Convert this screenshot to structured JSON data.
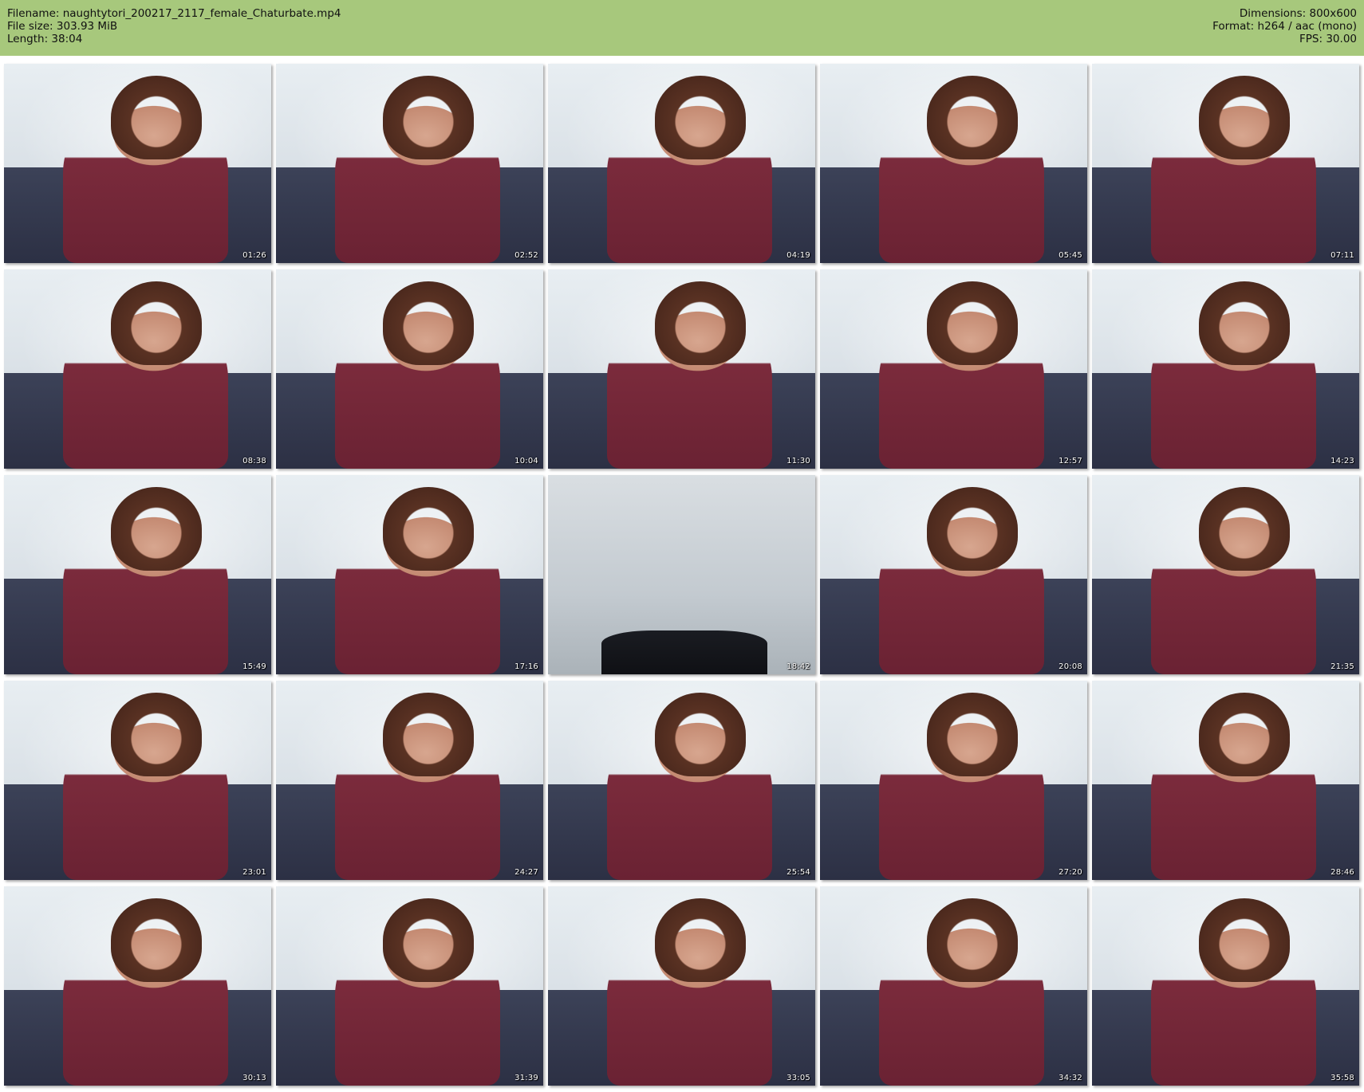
{
  "header": {
    "filename": "Filename: naughtytori_200217_2117_female_Chaturbate.mp4",
    "filesize": "File size: 303.93 MiB",
    "length": "Length: 38:04",
    "dimensions": "Dimensions: 800x600",
    "format": "Format: h264 / aac (mono)",
    "fps": "FPS: 30.00",
    "background_color": "#a7c87c"
  },
  "thumbnails": [
    {
      "timestamp": "01:26"
    },
    {
      "timestamp": "02:52"
    },
    {
      "timestamp": "04:19"
    },
    {
      "timestamp": "05:45"
    },
    {
      "timestamp": "07:11"
    },
    {
      "timestamp": "08:38"
    },
    {
      "timestamp": "10:04"
    },
    {
      "timestamp": "11:30"
    },
    {
      "timestamp": "12:57"
    },
    {
      "timestamp": "14:23"
    },
    {
      "timestamp": "15:49"
    },
    {
      "timestamp": "17:16"
    },
    {
      "timestamp": "18:42"
    },
    {
      "timestamp": "20:08"
    },
    {
      "timestamp": "21:35"
    },
    {
      "timestamp": "23:01"
    },
    {
      "timestamp": "24:27"
    },
    {
      "timestamp": "25:54"
    },
    {
      "timestamp": "27:20"
    },
    {
      "timestamp": "28:46"
    },
    {
      "timestamp": "30:13"
    },
    {
      "timestamp": "31:39"
    },
    {
      "timestamp": "33:05"
    },
    {
      "timestamp": "34:32"
    },
    {
      "timestamp": "35:58"
    }
  ]
}
